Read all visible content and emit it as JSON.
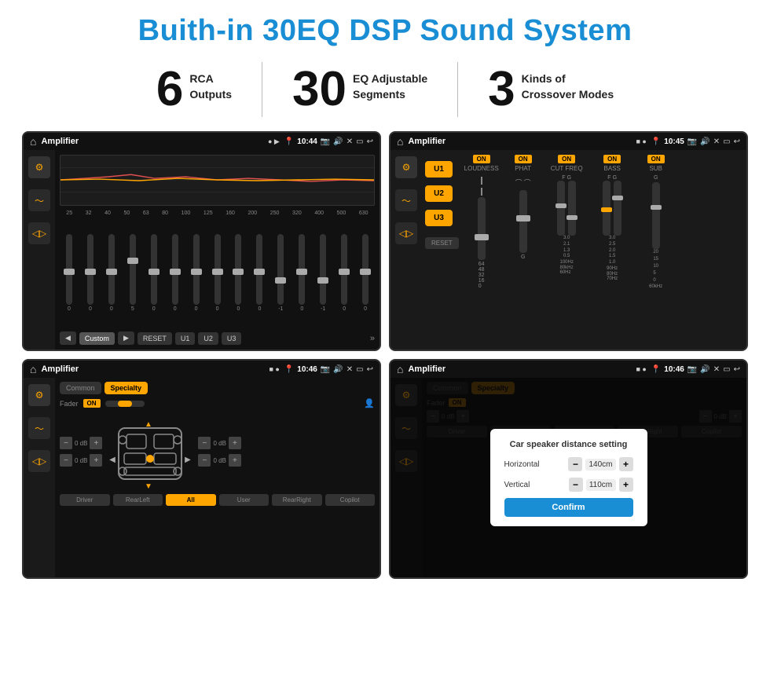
{
  "page": {
    "title": "Buith-in 30EQ DSP Sound System",
    "stats": [
      {
        "number": "6",
        "label": "RCA\nOutputs"
      },
      {
        "number": "30",
        "label": "EQ Adjustable\nSegments"
      },
      {
        "number": "3",
        "label": "Kinds of\nCrossover Modes"
      }
    ]
  },
  "screens": [
    {
      "id": "eq-screen",
      "status": {
        "title": "Amplifier",
        "time": "10:44"
      },
      "type": "eq"
    },
    {
      "id": "crossover-screen",
      "status": {
        "title": "Amplifier",
        "time": "10:45"
      },
      "type": "crossover"
    },
    {
      "id": "speaker-screen",
      "status": {
        "title": "Amplifier",
        "time": "10:46"
      },
      "type": "speaker"
    },
    {
      "id": "distance-screen",
      "status": {
        "title": "Amplifier",
        "time": "10:46"
      },
      "type": "distance",
      "dialog": {
        "title": "Car speaker distance setting",
        "horizontal_label": "Horizontal",
        "horizontal_value": "140cm",
        "vertical_label": "Vertical",
        "vertical_value": "110cm",
        "confirm_label": "Confirm"
      }
    }
  ],
  "eq": {
    "frequencies": [
      "25",
      "32",
      "40",
      "50",
      "63",
      "80",
      "100",
      "125",
      "160",
      "200",
      "250",
      "320",
      "400",
      "500",
      "630"
    ],
    "values": [
      "0",
      "0",
      "0",
      "5",
      "0",
      "0",
      "0",
      "0",
      "0",
      "0",
      "-1",
      "0",
      "-1",
      "0",
      "0"
    ],
    "presets": [
      "Custom",
      "RESET",
      "U1",
      "U2",
      "U3"
    ]
  },
  "crossover": {
    "u_buttons": [
      "U1",
      "U2",
      "U3"
    ],
    "controls": [
      {
        "label": "LOUDNESS",
        "on": true
      },
      {
        "label": "PHAT",
        "on": true
      },
      {
        "label": "CUT FREQ",
        "on": true
      },
      {
        "label": "BASS",
        "on": true
      },
      {
        "label": "SUB",
        "on": true
      }
    ],
    "reset_label": "RESET"
  },
  "speaker": {
    "tabs": [
      "Common",
      "Specialty"
    ],
    "fader_label": "Fader",
    "fader_on": "ON",
    "db_values": [
      "0 dB",
      "0 dB",
      "0 dB",
      "0 dB"
    ],
    "buttons": [
      "Driver",
      "RearLeft",
      "All",
      "User",
      "RearRight",
      "Copilot"
    ]
  },
  "distance": {
    "tabs": [
      "Common",
      "Specialty"
    ],
    "confirm": "Confirm",
    "horizontal": {
      "label": "Horizontal",
      "value": "140cm"
    },
    "vertical": {
      "label": "Vertical",
      "value": "110cm"
    }
  }
}
